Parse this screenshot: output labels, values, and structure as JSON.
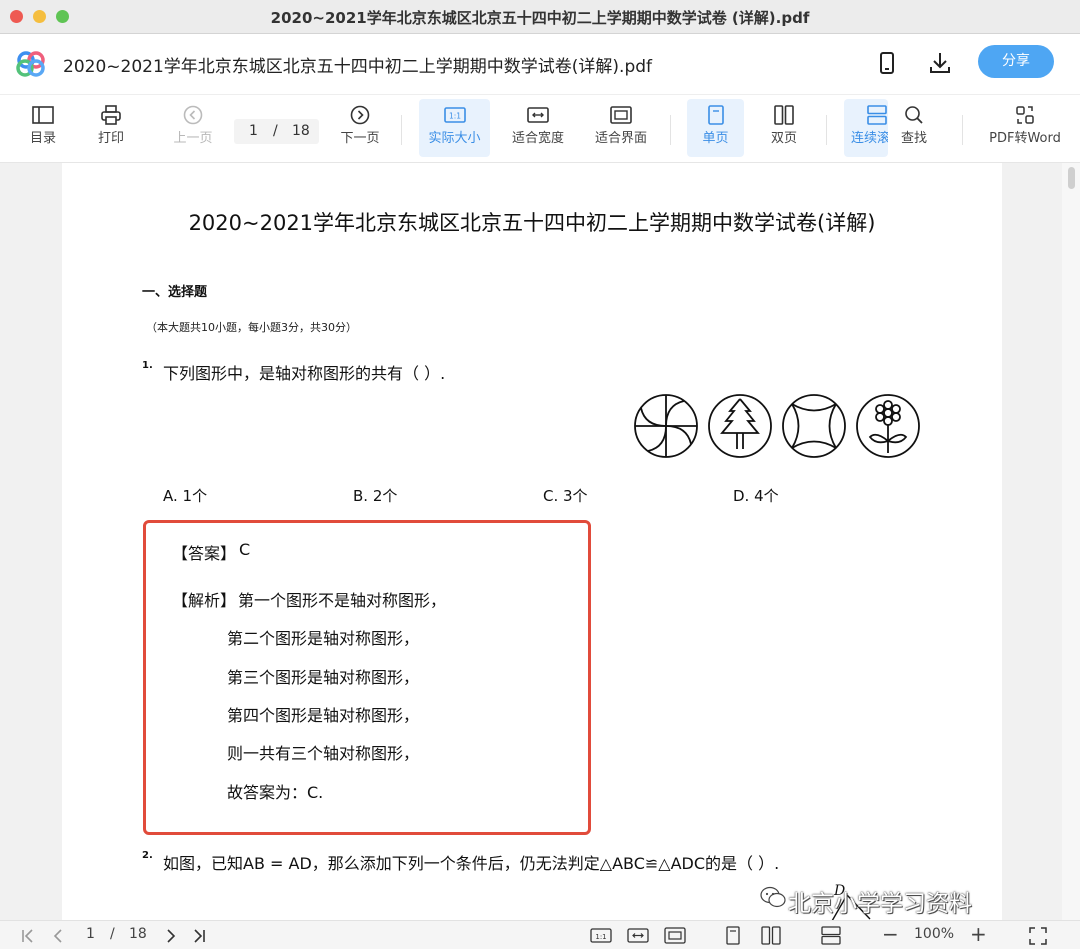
{
  "window": {
    "title": "2020~2021学年北京东城区北京五十四中初二上学期期中数学试卷 (详解).pdf"
  },
  "header": {
    "doc_title": "2020~2021学年北京东城区北京五十四中初二上学期期中数学试卷(详解).pdf",
    "share_label": "分享"
  },
  "toolbar": {
    "toc": "目录",
    "print": "打印",
    "prev": "上一页",
    "page_current": "1",
    "page_sep": "/",
    "page_total": "18",
    "next": "下一页",
    "actual_size": "实际大小",
    "fit_width": "适合宽度",
    "fit_window": "适合界面",
    "single_page": "单页",
    "double_page": "双页",
    "continuous": "连续滚",
    "find": "查找",
    "pdf_to_word": "PDF转Word"
  },
  "document": {
    "title": "2020~2021学年北京东城区北京五十四中初二上学期期中数学试卷(详解)",
    "section": "一、选择题",
    "note": "（本大题共10小题，每小题3分，共30分）",
    "q1": {
      "num": "1.",
      "text": "下列图形中，是轴对称图形的共有（   ）.",
      "options": [
        "A. 1个",
        "B. 2个",
        "C. 3个",
        "D. 4个"
      ]
    },
    "answer": {
      "answer_label": "【答案】",
      "answer_value": "C",
      "analysis_label": "【解析】",
      "lines": [
        "第一个图形不是轴对称图形，",
        "第二个图形是轴对称图形，",
        "第三个图形是轴对称图形，",
        "第四个图形是轴对称图形，",
        "则一共有三个轴对称图形，",
        "故答案为：C."
      ]
    },
    "q2": {
      "num": "2.",
      "text": "如图，已知AB = AD，那么添加下列一个条件后，仍无法判定△ABC≌△ADC的是（   ）."
    },
    "figure_label": "D"
  },
  "watermark": "北京小学学习资料",
  "statusbar": {
    "page_current": "1",
    "page_sep": "/",
    "page_total": "18",
    "zoom": "100%"
  },
  "colors": {
    "accent": "#4ea6f3",
    "answer_border": "#e14b3b"
  }
}
